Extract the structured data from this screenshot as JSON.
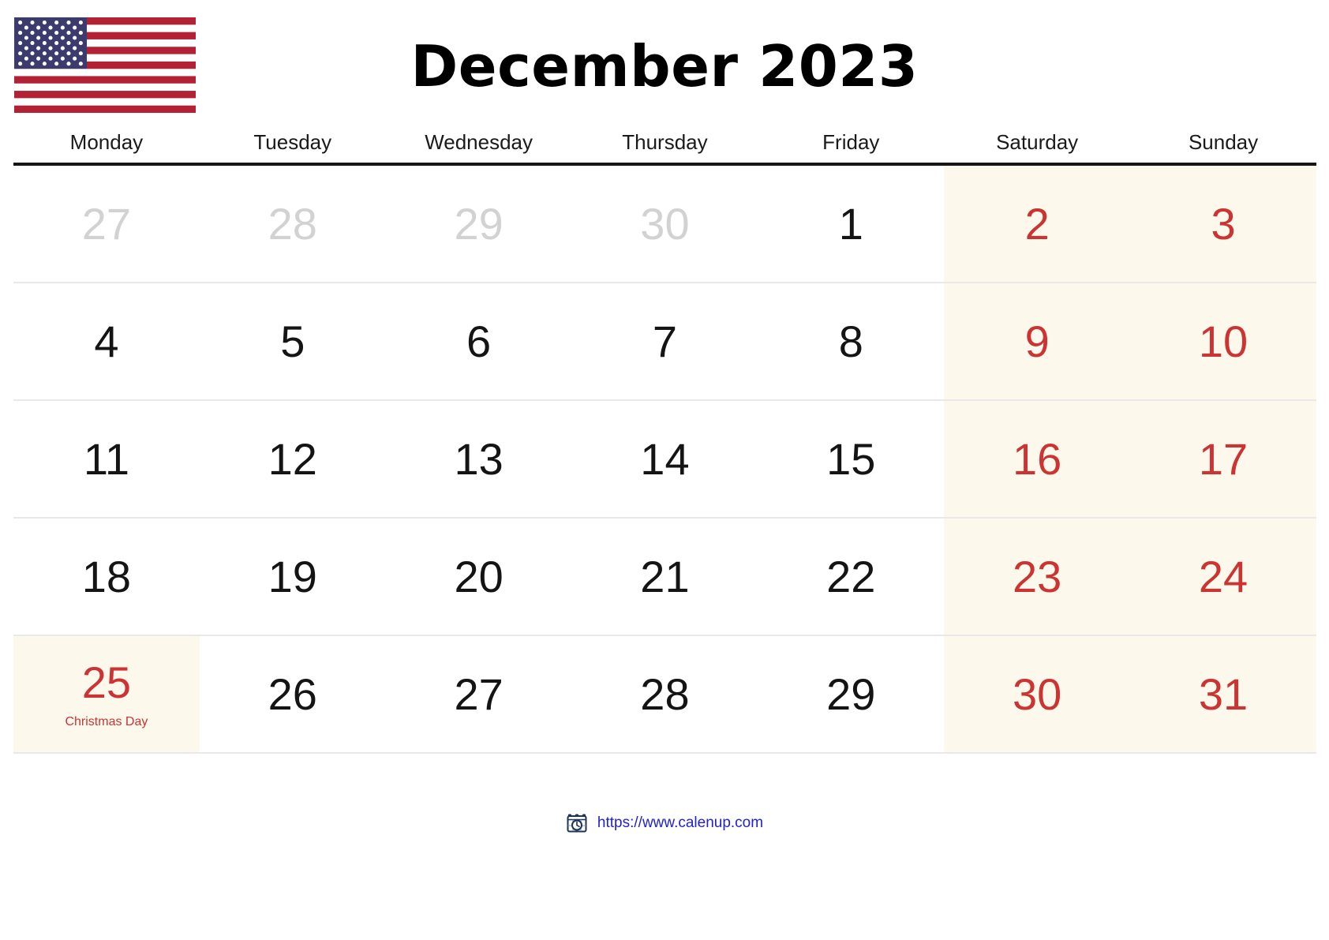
{
  "header": {
    "flag_icon": "us-flag-icon",
    "flag_alt": "United States flag",
    "title": "December 2023"
  },
  "calendar": {
    "weekday_headers": [
      "Monday",
      "Tuesday",
      "Wednesday",
      "Thursday",
      "Friday",
      "Saturday",
      "Sunday"
    ],
    "weekend_columns": [
      5,
      6
    ],
    "colors": {
      "weekend_background": "#fdf8ec",
      "weekend_text": "#cc3333",
      "holiday_text": "#cc3333",
      "other_month_text": "#d2d2d2",
      "day_text": "#141414",
      "header_rule": "#161616",
      "row_divider": "#e9e9e9",
      "link": "#2222cc"
    },
    "weeks": [
      [
        {
          "num": "27",
          "muted": true,
          "red": false,
          "shade": false,
          "holiday": ""
        },
        {
          "num": "28",
          "muted": true,
          "red": false,
          "shade": false,
          "holiday": ""
        },
        {
          "num": "29",
          "muted": true,
          "red": false,
          "shade": false,
          "holiday": ""
        },
        {
          "num": "30",
          "muted": true,
          "red": false,
          "shade": false,
          "holiday": ""
        },
        {
          "num": "1",
          "muted": false,
          "red": false,
          "shade": false,
          "holiday": ""
        },
        {
          "num": "2",
          "muted": false,
          "red": true,
          "shade": true,
          "holiday": ""
        },
        {
          "num": "3",
          "muted": false,
          "red": true,
          "shade": true,
          "holiday": ""
        }
      ],
      [
        {
          "num": "4",
          "muted": false,
          "red": false,
          "shade": false,
          "holiday": ""
        },
        {
          "num": "5",
          "muted": false,
          "red": false,
          "shade": false,
          "holiday": ""
        },
        {
          "num": "6",
          "muted": false,
          "red": false,
          "shade": false,
          "holiday": ""
        },
        {
          "num": "7",
          "muted": false,
          "red": false,
          "shade": false,
          "holiday": ""
        },
        {
          "num": "8",
          "muted": false,
          "red": false,
          "shade": false,
          "holiday": ""
        },
        {
          "num": "9",
          "muted": false,
          "red": true,
          "shade": true,
          "holiday": ""
        },
        {
          "num": "10",
          "muted": false,
          "red": true,
          "shade": true,
          "holiday": ""
        }
      ],
      [
        {
          "num": "11",
          "muted": false,
          "red": false,
          "shade": false,
          "holiday": ""
        },
        {
          "num": "12",
          "muted": false,
          "red": false,
          "shade": false,
          "holiday": ""
        },
        {
          "num": "13",
          "muted": false,
          "red": false,
          "shade": false,
          "holiday": ""
        },
        {
          "num": "14",
          "muted": false,
          "red": false,
          "shade": false,
          "holiday": ""
        },
        {
          "num": "15",
          "muted": false,
          "red": false,
          "shade": false,
          "holiday": ""
        },
        {
          "num": "16",
          "muted": false,
          "red": true,
          "shade": true,
          "holiday": ""
        },
        {
          "num": "17",
          "muted": false,
          "red": true,
          "shade": true,
          "holiday": ""
        }
      ],
      [
        {
          "num": "18",
          "muted": false,
          "red": false,
          "shade": false,
          "holiday": ""
        },
        {
          "num": "19",
          "muted": false,
          "red": false,
          "shade": false,
          "holiday": ""
        },
        {
          "num": "20",
          "muted": false,
          "red": false,
          "shade": false,
          "holiday": ""
        },
        {
          "num": "21",
          "muted": false,
          "red": false,
          "shade": false,
          "holiday": ""
        },
        {
          "num": "22",
          "muted": false,
          "red": false,
          "shade": false,
          "holiday": ""
        },
        {
          "num": "23",
          "muted": false,
          "red": true,
          "shade": true,
          "holiday": ""
        },
        {
          "num": "24",
          "muted": false,
          "red": true,
          "shade": true,
          "holiday": ""
        }
      ],
      [
        {
          "num": "25",
          "muted": false,
          "red": true,
          "shade": true,
          "holiday": "Christmas Day"
        },
        {
          "num": "26",
          "muted": false,
          "red": false,
          "shade": false,
          "holiday": ""
        },
        {
          "num": "27",
          "muted": false,
          "red": false,
          "shade": false,
          "holiday": ""
        },
        {
          "num": "28",
          "muted": false,
          "red": false,
          "shade": false,
          "holiday": ""
        },
        {
          "num": "29",
          "muted": false,
          "red": false,
          "shade": false,
          "holiday": ""
        },
        {
          "num": "30",
          "muted": false,
          "red": true,
          "shade": true,
          "holiday": ""
        },
        {
          "num": "31",
          "muted": false,
          "red": true,
          "shade": true,
          "holiday": ""
        }
      ]
    ]
  },
  "footer": {
    "icon": "calendar-clock-icon",
    "link_text": "https://www.calenup.com"
  }
}
